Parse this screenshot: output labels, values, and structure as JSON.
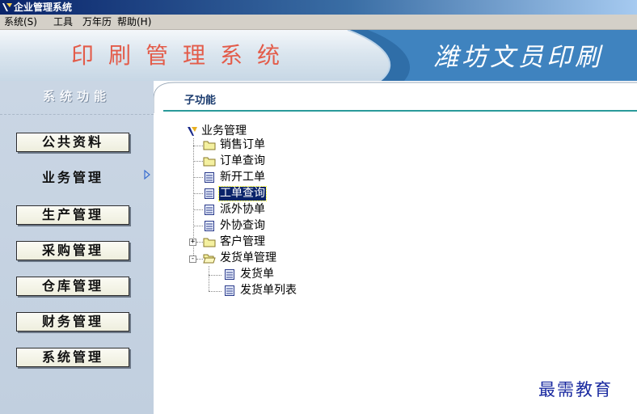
{
  "window": {
    "title": "企业管理系统"
  },
  "menu": [
    "系统(S)",
    "工具",
    "万年历",
    "帮助(H)"
  ],
  "banner": {
    "left_title": "印刷管理系统",
    "right_title": "潍坊文员印刷"
  },
  "sidebar": {
    "header": "系统功能",
    "items": [
      {
        "label": "公共资料",
        "active": false
      },
      {
        "label": "业务管理",
        "active": true
      },
      {
        "label": "生产管理",
        "active": false
      },
      {
        "label": "采购管理",
        "active": false
      },
      {
        "label": "仓库管理",
        "active": false
      },
      {
        "label": "财务管理",
        "active": false
      },
      {
        "label": "系统管理",
        "active": false
      }
    ]
  },
  "panel": {
    "tab_label": "子功能"
  },
  "tree": {
    "root": "业务管理",
    "items": [
      {
        "label": "销售订单",
        "icon": "folder-icon"
      },
      {
        "label": "订单查询",
        "icon": "folder-icon"
      },
      {
        "label": "新开工单",
        "icon": "document-icon"
      },
      {
        "label": "工单查询",
        "icon": "document-icon",
        "selected": true
      },
      {
        "label": "派外协单",
        "icon": "document-icon"
      },
      {
        "label": "外协查询",
        "icon": "document-icon"
      },
      {
        "label": "客户管理",
        "icon": "folder-icon",
        "expander": "+"
      },
      {
        "label": "发货单管理",
        "icon": "folder-open-icon",
        "expander": "-"
      }
    ],
    "children": [
      {
        "label": "发货单",
        "icon": "document-icon"
      },
      {
        "label": "发货单列表",
        "icon": "document-icon"
      }
    ]
  },
  "watermark": "最需教育",
  "colors": {
    "title_bar": "#0a246a",
    "menu_bg": "#d4d0c8",
    "sidebar_bg": "#c6d3e2",
    "selection": "#0a246a",
    "accent_line": "#2a9a9a"
  }
}
